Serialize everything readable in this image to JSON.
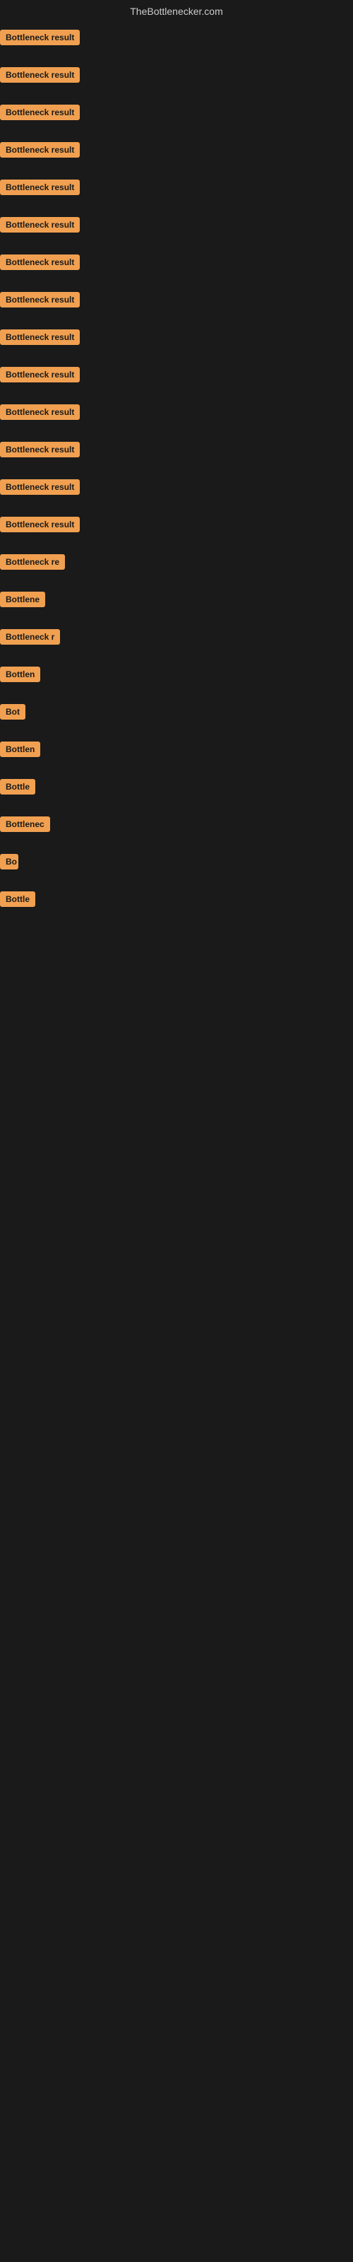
{
  "header": {
    "title": "TheBottlenecker.com"
  },
  "items": [
    {
      "label": "Bottleneck result",
      "width": 120
    },
    {
      "label": "Bottleneck result",
      "width": 120
    },
    {
      "label": "Bottleneck result",
      "width": 120
    },
    {
      "label": "Bottleneck result",
      "width": 120
    },
    {
      "label": "Bottleneck result",
      "width": 120
    },
    {
      "label": "Bottleneck result",
      "width": 120
    },
    {
      "label": "Bottleneck result",
      "width": 120
    },
    {
      "label": "Bottleneck result",
      "width": 120
    },
    {
      "label": "Bottleneck result",
      "width": 120
    },
    {
      "label": "Bottleneck result",
      "width": 120
    },
    {
      "label": "Bottleneck result",
      "width": 120
    },
    {
      "label": "Bottleneck result",
      "width": 120
    },
    {
      "label": "Bottleneck result",
      "width": 120
    },
    {
      "label": "Bottleneck result",
      "width": 120
    },
    {
      "label": "Bottleneck re",
      "width": 96
    },
    {
      "label": "Bottlene",
      "width": 72
    },
    {
      "label": "Bottleneck r",
      "width": 86
    },
    {
      "label": "Bottlen",
      "width": 62
    },
    {
      "label": "Bot",
      "width": 36
    },
    {
      "label": "Bottlen",
      "width": 60
    },
    {
      "label": "Bottle",
      "width": 52
    },
    {
      "label": "Bottlenec",
      "width": 74
    },
    {
      "label": "Bo",
      "width": 26
    },
    {
      "label": "Bottle",
      "width": 50
    }
  ]
}
